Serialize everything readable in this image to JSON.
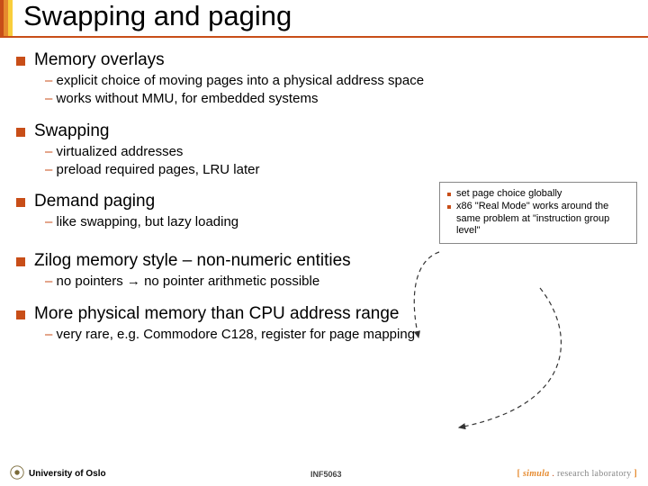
{
  "title": "Swapping and paging",
  "sections": [
    {
      "heading": "Memory overlays",
      "subs": [
        "explicit choice of moving pages into a physical address space",
        "works without MMU, for embedded systems"
      ]
    },
    {
      "heading": "Swapping",
      "subs": [
        "virtualized addresses",
        "preload required pages, LRU later"
      ]
    },
    {
      "heading": "Demand paging",
      "subs": [
        "like swapping, but lazy loading"
      ]
    },
    {
      "heading": "Zilog memory style – non-numeric entities",
      "subs": [
        "no pointers → no pointer arithmetic possible"
      ]
    },
    {
      "heading": "More physical memory than CPU address range",
      "subs": [
        "very rare, e.g. Commodore C128, register for page mapping"
      ]
    }
  ],
  "notebox": {
    "items": [
      "set page choice globally",
      "x86 \"Real Mode\" works around the same problem at \"instruction group level\""
    ]
  },
  "footer": {
    "uio": "University of Oslo",
    "course": "INF5063",
    "simula_brackets": [
      "[ ",
      " ]"
    ],
    "simula_core": "simula",
    "simula_tail": "research laboratory"
  }
}
